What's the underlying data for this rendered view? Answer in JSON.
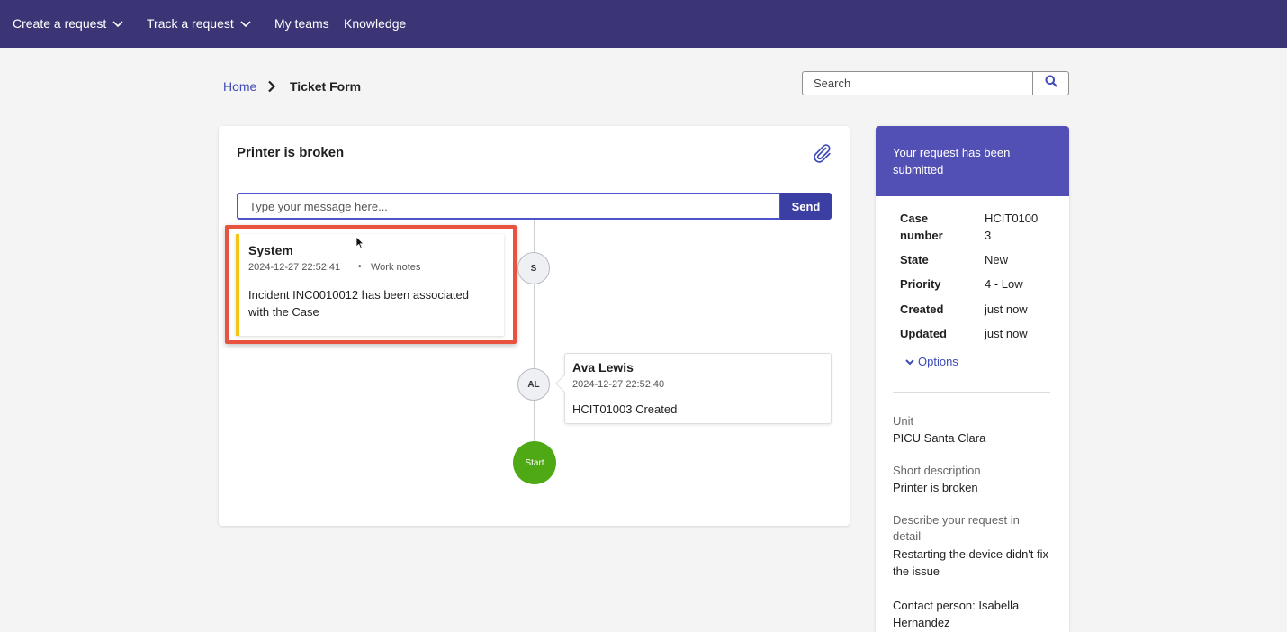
{
  "nav": {
    "create_request": "Create a request",
    "track_request": "Track a request",
    "my_teams": "My teams",
    "knowledge": "Knowledge"
  },
  "breadcrumb": {
    "home": "Home",
    "current": "Ticket Form"
  },
  "search": {
    "placeholder": "Search"
  },
  "ticket": {
    "title": "Printer is broken",
    "message_placeholder": "Type your message here...",
    "send_label": "Send"
  },
  "timeline": {
    "entries": [
      {
        "initials": "S",
        "author": "System",
        "timestamp": "2024-12-27 22:52:41",
        "separator": "•",
        "type": "Work notes",
        "body": "Incident INC0010012 has been associated with the Case"
      },
      {
        "initials": "AL",
        "author": "Ava Lewis",
        "timestamp": "2024-12-27 22:52:40",
        "body": "HCIT01003 Created"
      }
    ],
    "start_label": "Start"
  },
  "side_panel": {
    "header": "Your request has been submitted",
    "details": [
      {
        "label": "Case number",
        "value": "HCIT0100 3"
      },
      {
        "label": "State",
        "value": "New"
      },
      {
        "label": "Priority",
        "value": "4 - Low"
      },
      {
        "label": "Created",
        "value": "just now"
      },
      {
        "label": "Updated",
        "value": "just now"
      }
    ],
    "options_label": "Options",
    "fields": [
      {
        "label": "Unit",
        "value": "PICU Santa Clara"
      },
      {
        "label": "Short description",
        "value": "Printer is broken"
      },
      {
        "label": "Describe your request in detail",
        "value": "Restarting the device didn't fix the issue"
      }
    ],
    "contact": "Contact person: Isabella Hernandez"
  },
  "colors": {
    "nav_bg": "#3b3576",
    "accent": "#5250b5",
    "link": "#3f4bb8",
    "highlight": "#e8533f",
    "work_note_bar": "#f4c613",
    "start_node": "#4ea914"
  },
  "icons": [
    "chevron-down-icon",
    "chevron-right-icon",
    "search-icon",
    "paperclip-icon",
    "cursor-pointer"
  ]
}
